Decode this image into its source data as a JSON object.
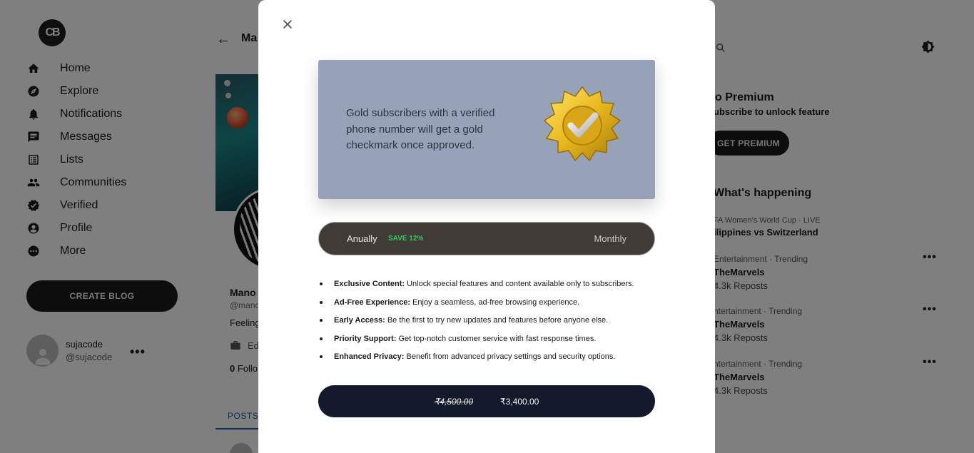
{
  "sidebar": {
    "logo_text": "CB",
    "items": [
      {
        "label": "Home",
        "icon": "home-icon"
      },
      {
        "label": "Explore",
        "icon": "compass-icon"
      },
      {
        "label": "Notifications",
        "icon": "bell-icon"
      },
      {
        "label": "Messages",
        "icon": "message-icon"
      },
      {
        "label": "Lists",
        "icon": "list-icon"
      },
      {
        "label": "Communities",
        "icon": "people-icon"
      },
      {
        "label": "Verified",
        "icon": "verified-icon"
      },
      {
        "label": "Profile",
        "icon": "user-circle-icon"
      },
      {
        "label": "More",
        "icon": "more-circle-icon"
      }
    ],
    "create_blog": "CREATE BLOG",
    "user": {
      "name": "sujacode",
      "handle": "@sujacode",
      "more": "•••"
    }
  },
  "profile": {
    "back": "←",
    "title": "Ma",
    "name": "Mano",
    "handle": "@manc",
    "bio": "Feeling",
    "edit": "Ed",
    "followers_count": "0",
    "followers_label": "Follo",
    "tab": "POSTS"
  },
  "right": {
    "premium_title": "o Premium",
    "premium_sub": "ubscribe to unlock feature",
    "premium_button": "GET PREMIUM",
    "whats_happening": "What's happening",
    "trends": [
      {
        "category": "FA Women's World Cup · LIVE",
        "title": "ilippines vs Switzerland",
        "reposts": ""
      },
      {
        "category": "Entertainment · Trending",
        "title": "TheMarvels",
        "reposts": "4.3k Reposts"
      },
      {
        "category": "ntertainment · Trending",
        "title": "TheMarvels",
        "reposts": "4.3k Reposts"
      },
      {
        "category": "ntertainment · Trending",
        "title": "TheMarvels",
        "reposts": "4.3k Reposts"
      }
    ],
    "trend_more": "•••"
  },
  "modal": {
    "hero_text": "Gold subscribers with a verified phone number will get a gold checkmark once approved.",
    "toggle": {
      "annual": "Anually",
      "save": "SAVE 12%",
      "monthly": "Monthly"
    },
    "features": [
      {
        "title": "Exclusive Content:",
        "desc": " Unlock special features and content available only to subscribers."
      },
      {
        "title": "Ad-Free Experience:",
        "desc": " Enjoy a seamless, ad-free browsing experience."
      },
      {
        "title": "Early Access:",
        "desc": " Be the first to try new updates and features before anyone else."
      },
      {
        "title": "Priority Support:",
        "desc": " Get top-notch customer service with fast response times."
      },
      {
        "title": "Enhanced Privacy:",
        "desc": " Benefit from advanced privacy settings and security options."
      }
    ],
    "price_old": "₹4,500.00",
    "price_new": "₹3,400.00"
  },
  "colors": {
    "overlay": "#000000",
    "modal_hero": "#95a2b8",
    "toggle_bg": "#403b36",
    "save_green": "#35c760",
    "buy_button": "#121a2b",
    "gold": "#e8b81c"
  }
}
